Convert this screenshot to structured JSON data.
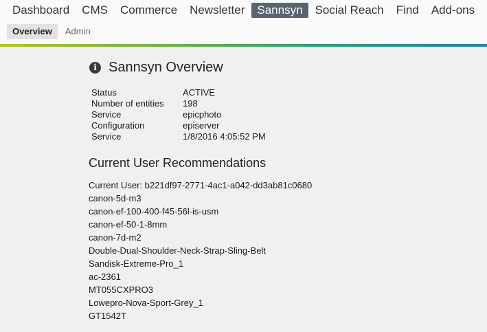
{
  "nav": {
    "items": [
      "Dashboard",
      "CMS",
      "Commerce",
      "Newsletter",
      "Sannsyn",
      "Social Reach",
      "Find",
      "Add-ons"
    ],
    "active": "Sannsyn"
  },
  "subnav": {
    "items": [
      "Overview",
      "Admin"
    ],
    "active": "Overview"
  },
  "overview": {
    "title": "Sannsyn Overview",
    "icon": "info-icon"
  },
  "status": {
    "rows": [
      {
        "label": "Status",
        "value": "ACTIVE"
      },
      {
        "label": "Number of entities",
        "value": "198"
      },
      {
        "label": "Service",
        "value": "epicphoto"
      },
      {
        "label": "Configuration",
        "value": "episerver"
      },
      {
        "label": "Service",
        "value": "1/8/2016 4:05:52 PM"
      }
    ]
  },
  "recommendations": {
    "title": "Current User Recommendations",
    "current_user_label": "Current User: b221df97-2771-4ac1-a042-dd3ab81c0680",
    "items": [
      "canon-5d-m3",
      "canon-ef-100-400-f45-56l-is-usm",
      "canon-ef-50-1-8mm",
      "canon-7d-m2",
      "Double-Dual-Shoulder-Neck-Strap-Sling-Belt",
      "Sandisk-Extreme-Pro_1",
      "ac-2361",
      "MT055CXPRO3",
      "Lowepro-Nova-Sport-Grey_1",
      "GT1542T"
    ]
  },
  "colors": {
    "active_nav_bg": "#5a6470",
    "accent_gradient": [
      "#b3c321",
      "#6eb33f",
      "#2aa27a",
      "#1f83a8"
    ],
    "page_bg": "#f0f0f0"
  }
}
